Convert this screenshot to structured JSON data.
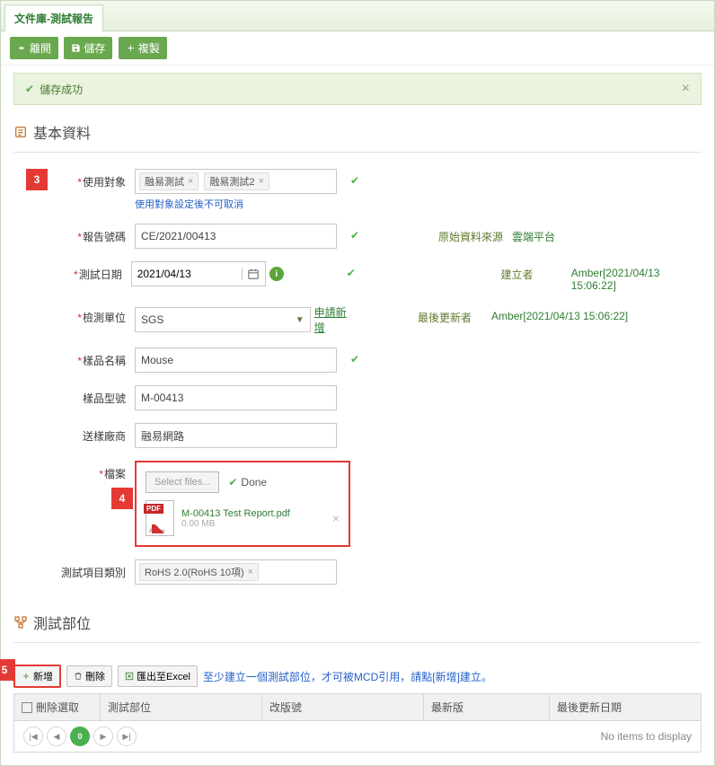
{
  "header": {
    "tab_label": "文件庫-測試報告"
  },
  "toolbar": {
    "leave": "離開",
    "save": "儲存",
    "copy": "複製"
  },
  "alert": {
    "message": "儲存成功"
  },
  "section_basic": "基本資料",
  "callouts": {
    "c3": "3",
    "c4": "4",
    "c5": "5"
  },
  "fields": {
    "target": {
      "label": "使用對象",
      "tag1": "融易測試",
      "tag2": "融易測試2",
      "hint": "使用對象設定後不可取消"
    },
    "reportno": {
      "label": "報告號碼",
      "value": "CE/2021/00413"
    },
    "testdate": {
      "label": "測試日期",
      "value": "2021/04/13"
    },
    "testunit": {
      "label": "檢測單位",
      "value": "SGS",
      "link": "申請新增"
    },
    "sample": {
      "label": "樣品名稱",
      "value": "Mouse"
    },
    "model": {
      "label": "樣品型號",
      "value": "M-00413"
    },
    "vendor": {
      "label": "送樣廠商",
      "value": "融易網路"
    },
    "file": {
      "label": "檔案",
      "select_btn": "Select files...",
      "done": "Done",
      "filename": "M-00413 Test Report.pdf",
      "filesize": "0.00 MB"
    },
    "category": {
      "label": "測試項目類別",
      "value": "RoHS 2.0(RoHS 10項)"
    }
  },
  "meta": {
    "source_label": "原始資料來源",
    "source_value": "雲端平台",
    "creator_label": "建立者",
    "creator_value": "Amber[2021/04/13 15:06:22]",
    "updater_label": "最後更新者",
    "updater_value": "Amber[2021/04/13 15:06:22]"
  },
  "section_part": "測試部位",
  "grid_toolbar": {
    "add": "新增",
    "del": "刪除",
    "excel": "匯出至Excel",
    "hint": "至少建立一個測試部位，才可被MCD引用，請點[新增]建立。"
  },
  "grid": {
    "cols": {
      "c1": "刪除選取",
      "c2": "測試部位",
      "c3": "改版號",
      "c4": "最新版",
      "c5": "最後更新日期"
    },
    "page": "0",
    "noitems": "No items to display"
  }
}
